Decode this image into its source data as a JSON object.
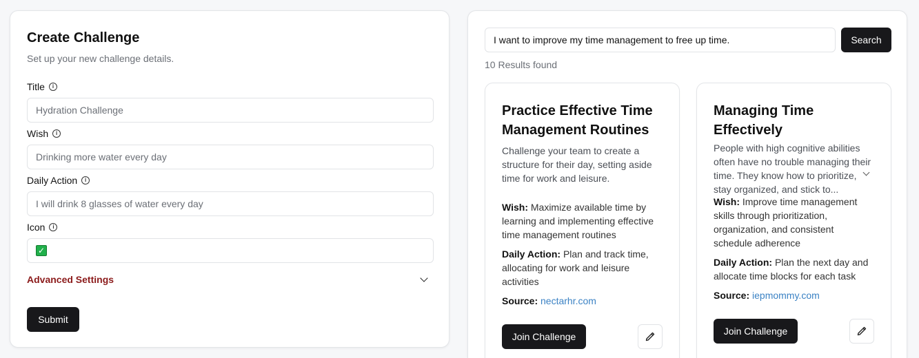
{
  "form": {
    "title": "Create Challenge",
    "subtitle": "Set up your new challenge details.",
    "fields": [
      {
        "label": "Title",
        "placeholder": "Hydration Challenge"
      },
      {
        "label": "Wish",
        "placeholder": "Drinking more water every day"
      },
      {
        "label": "Daily Action",
        "placeholder": "I will drink 8 glasses of water every day"
      },
      {
        "label": "Icon",
        "value": "✅"
      }
    ],
    "advanced_label": "Advanced Settings",
    "submit_label": "Submit"
  },
  "search": {
    "query": "I want to improve my time management to free up time.",
    "button_label": "Search",
    "results_text": "10 Results found"
  },
  "cards": [
    {
      "title": "Practice Effective Time Management Routines",
      "description": "Challenge your team to create a structure for their day, setting aside time for work and leisure.",
      "wish_label": "Wish:",
      "wish": "Maximize available time by learning and implementing effective time management routines",
      "action_label": "Daily Action:",
      "action": "Plan and track time, allocating for work and leisure activities",
      "source_label": "Source:",
      "source": "nectarhr.com",
      "join_label": "Join Challenge"
    },
    {
      "title": "Managing Time Effectively",
      "description": "People with high cognitive abilities often have no trouble managing their time. They know how to prioritize, stay organized, and stick to...",
      "wish_label": "Wish:",
      "wish": "Improve time management skills through prioritization, organization, and consistent schedule adherence",
      "action_label": "Daily Action:",
      "action": "Plan the next day and allocate time blocks for each task",
      "source_label": "Source:",
      "source": "iepmommy.com",
      "join_label": "Join Challenge"
    }
  ],
  "colors": {
    "accent_dark": "#18181b",
    "advanced_red": "#8b1a1a",
    "link_blue": "#3b82c4",
    "check_green": "#21b04b"
  }
}
